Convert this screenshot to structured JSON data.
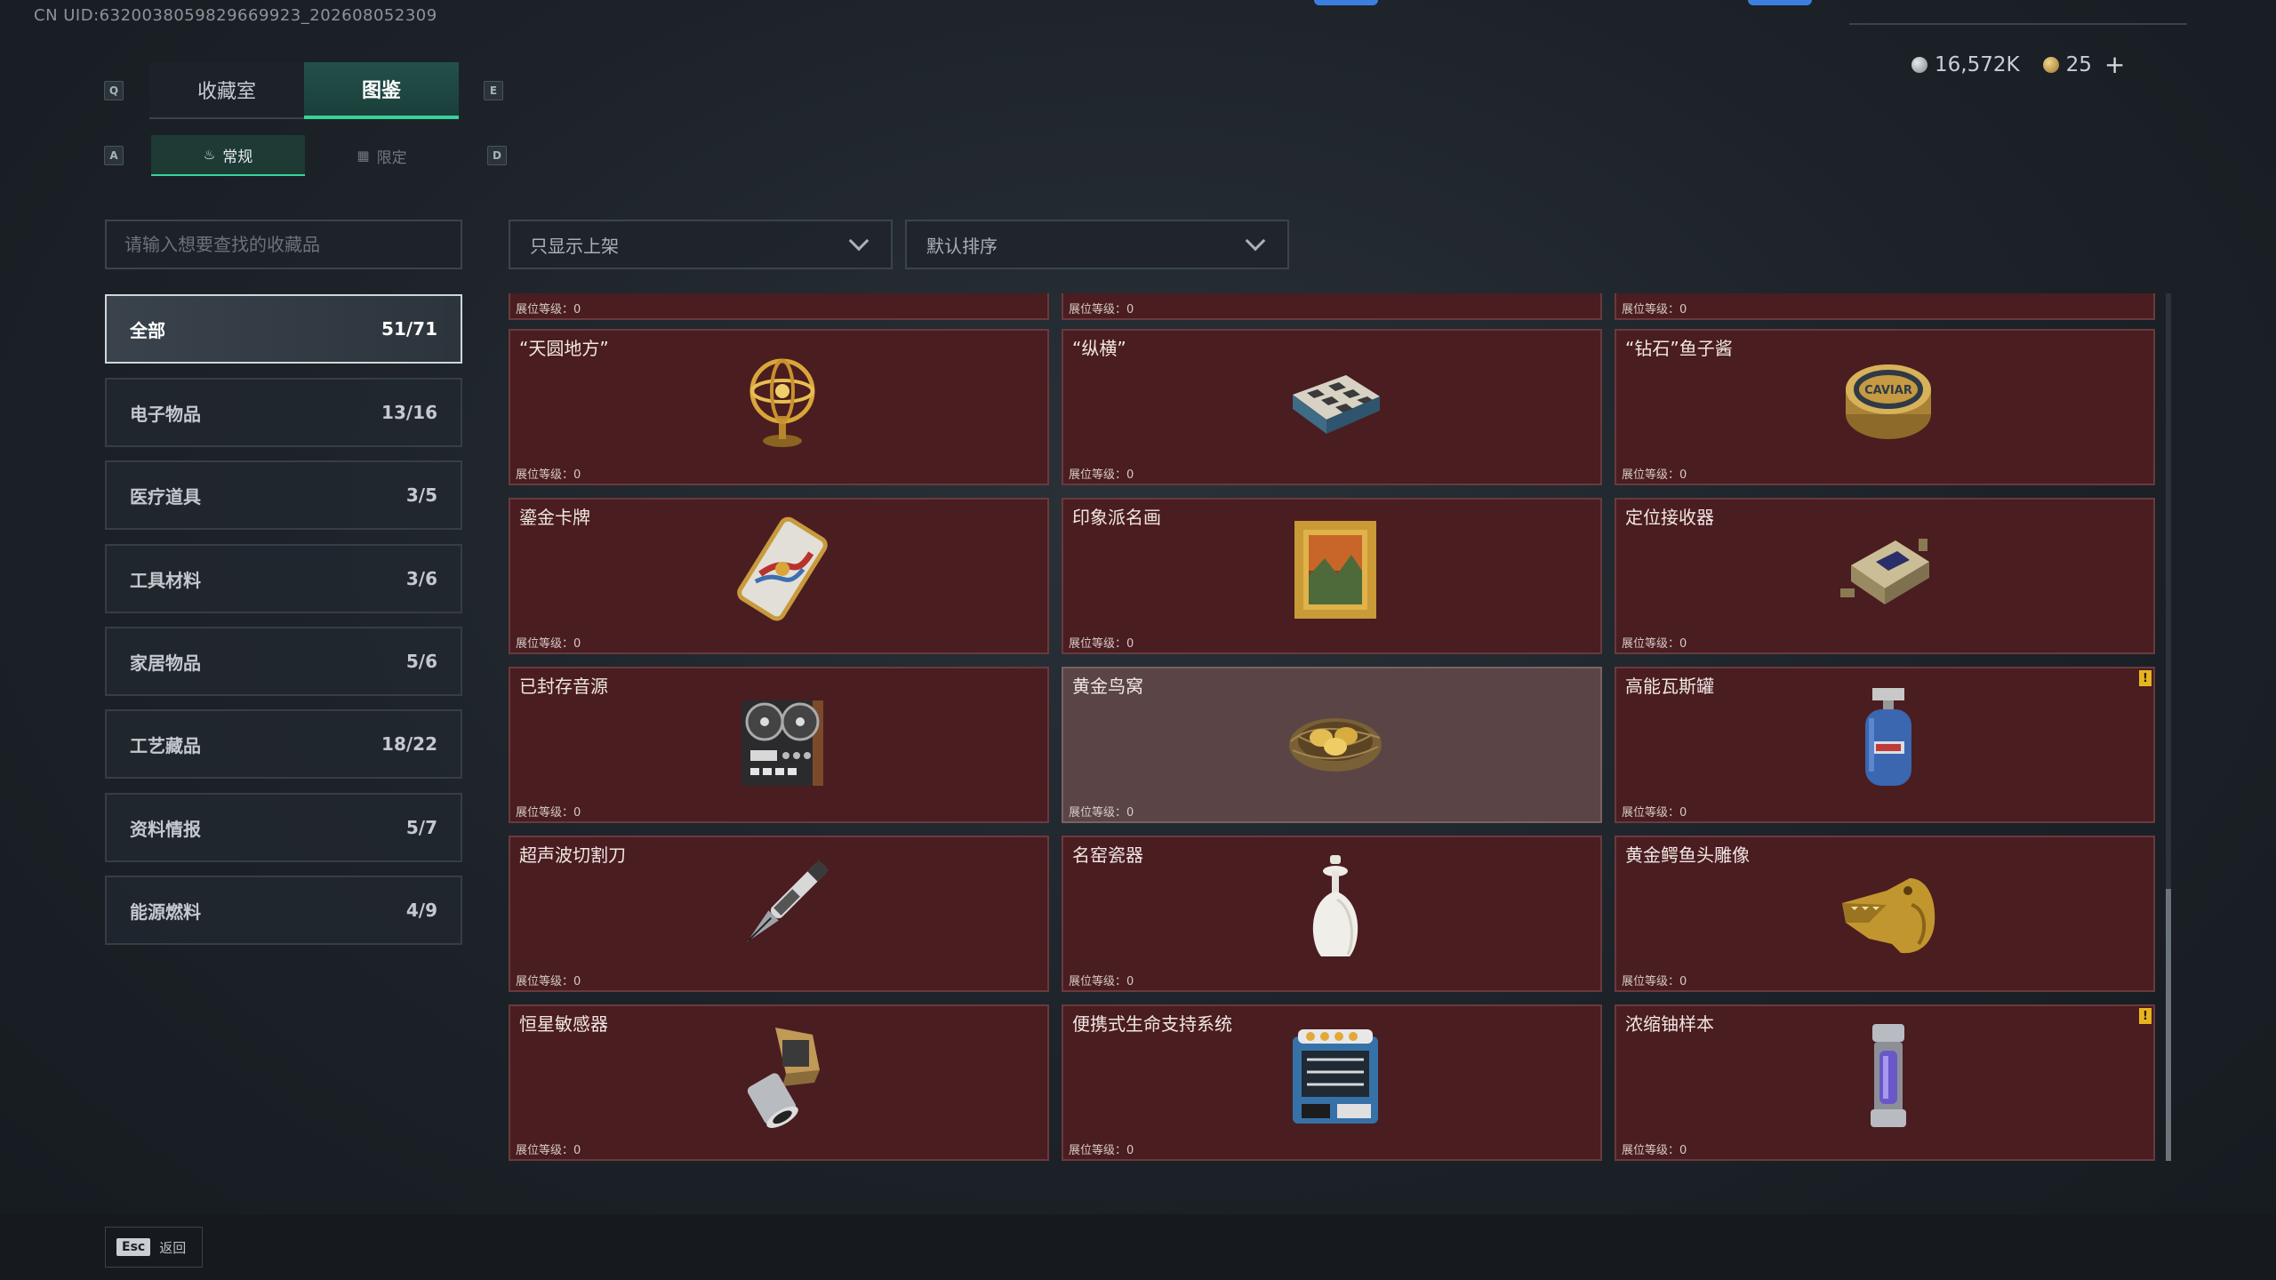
{
  "header": {
    "uid": "CN UID:6320038059829669923_202608052309",
    "currency": [
      {
        "icon": "silver-coin-icon",
        "value": "16,572K"
      },
      {
        "icon": "gold-coin-icon",
        "value": "25"
      }
    ],
    "add_label": "+"
  },
  "tabs": {
    "prev_key": "Q",
    "next_key": "E",
    "items": [
      {
        "label": "收藏室",
        "active": false
      },
      {
        "label": "图鉴",
        "active": true
      }
    ]
  },
  "subtabs": {
    "prev_key": "A",
    "next_key": "D",
    "items": [
      {
        "label": "常规",
        "icon": "flame-icon",
        "active": true
      },
      {
        "label": "限定",
        "icon": "card-icon",
        "active": false
      }
    ]
  },
  "search": {
    "placeholder": "请输入想要查找的收藏品"
  },
  "filters": {
    "shelf": "只显示上架",
    "sort": "默认排序"
  },
  "categories": [
    {
      "label": "全部",
      "count": "51/71",
      "active": true
    },
    {
      "label": "电子物品",
      "count": "13/16"
    },
    {
      "label": "医疗道具",
      "count": "3/5"
    },
    {
      "label": "工具材料",
      "count": "3/6"
    },
    {
      "label": "家居物品",
      "count": "5/6"
    },
    {
      "label": "工艺藏品",
      "count": "18/22"
    },
    {
      "label": "资料情报",
      "count": "5/7"
    },
    {
      "label": "能源燃料",
      "count": "4/9"
    }
  ],
  "level_label": "展位等级：0",
  "items": [
    {
      "name": "“天圆地方”",
      "icon": "armillary-sphere-icon"
    },
    {
      "name": "“纵横”",
      "icon": "chess-box-icon"
    },
    {
      "name": "“钻石”鱼子酱",
      "icon": "caviar-tin-icon"
    },
    {
      "name": "鎏金卡牌",
      "icon": "gilded-card-icon"
    },
    {
      "name": "印象派名画",
      "icon": "framed-painting-icon"
    },
    {
      "name": "定位接收器",
      "icon": "receiver-device-icon"
    },
    {
      "name": "已封存音源",
      "icon": "reel-recorder-icon"
    },
    {
      "name": "黄金鸟窝",
      "icon": "golden-nest-icon",
      "highlight": true
    },
    {
      "name": "高能瓦斯罐",
      "icon": "gas-canister-icon",
      "warning": "!"
    },
    {
      "name": "超声波切割刀",
      "icon": "cutter-knife-icon"
    },
    {
      "name": "名窑瓷器",
      "icon": "porcelain-vase-icon"
    },
    {
      "name": "黄金鳄鱼头雕像",
      "icon": "crocodile-statue-icon"
    },
    {
      "name": "恒星敏感器",
      "icon": "star-sensor-icon"
    },
    {
      "name": "便携式生命支持系统",
      "icon": "life-support-icon"
    },
    {
      "name": "浓缩铀样本",
      "icon": "uranium-sample-icon",
      "warning": "!"
    }
  ],
  "footer": {
    "esc_key": "Esc",
    "back_label": "返回"
  }
}
